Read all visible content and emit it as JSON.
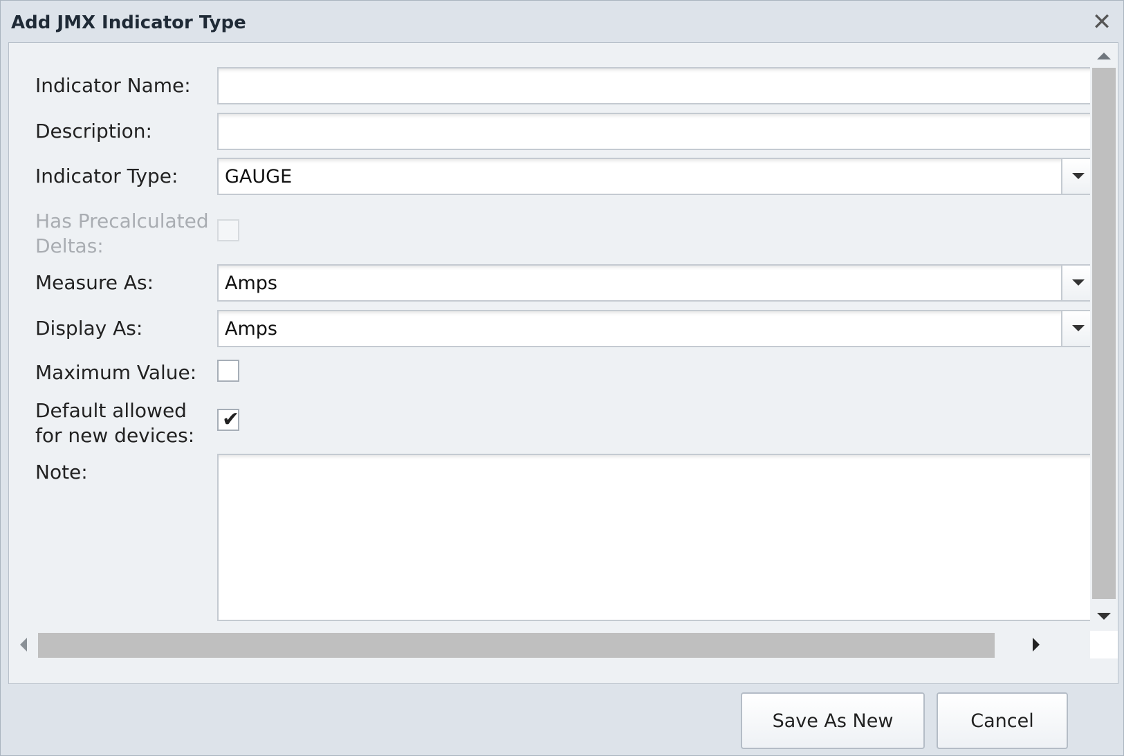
{
  "dialog": {
    "title": "Add JMX Indicator Type",
    "close_glyph": "✕",
    "close_icon": "close-icon"
  },
  "form": {
    "indicator_name": {
      "label": "Indicator Name:",
      "value": ""
    },
    "description": {
      "label": "Description:",
      "value": ""
    },
    "indicator_type": {
      "label": "Indicator Type:",
      "value": "GAUGE",
      "icon": "chevron-down-icon"
    },
    "has_precalculated_deltas": {
      "label_line1": "Has Precalculated",
      "label_line2": "Deltas:",
      "checked": false,
      "disabled": true
    },
    "measure_as": {
      "label": "Measure As:",
      "value": "Amps",
      "icon": "chevron-down-icon"
    },
    "display_as": {
      "label": "Display As:",
      "value": "Amps",
      "icon": "chevron-down-icon"
    },
    "maximum_value": {
      "label": "Maximum Value:",
      "checked": false
    },
    "default_allowed": {
      "label_line1": "Default allowed",
      "label_line2": "for new devices:",
      "checked": true,
      "check_glyph": "✔"
    },
    "note": {
      "label": "Note:",
      "value": ""
    }
  },
  "buttons": {
    "save_as_new": "Save As New",
    "cancel": "Cancel"
  },
  "colors": {
    "dialog_bg": "#dde3ea",
    "panel_bg": "#eef1f4",
    "field_border": "#c4cad1",
    "scroll_thumb": "#bfbfbf",
    "disabled_text": "#a9adb2"
  }
}
